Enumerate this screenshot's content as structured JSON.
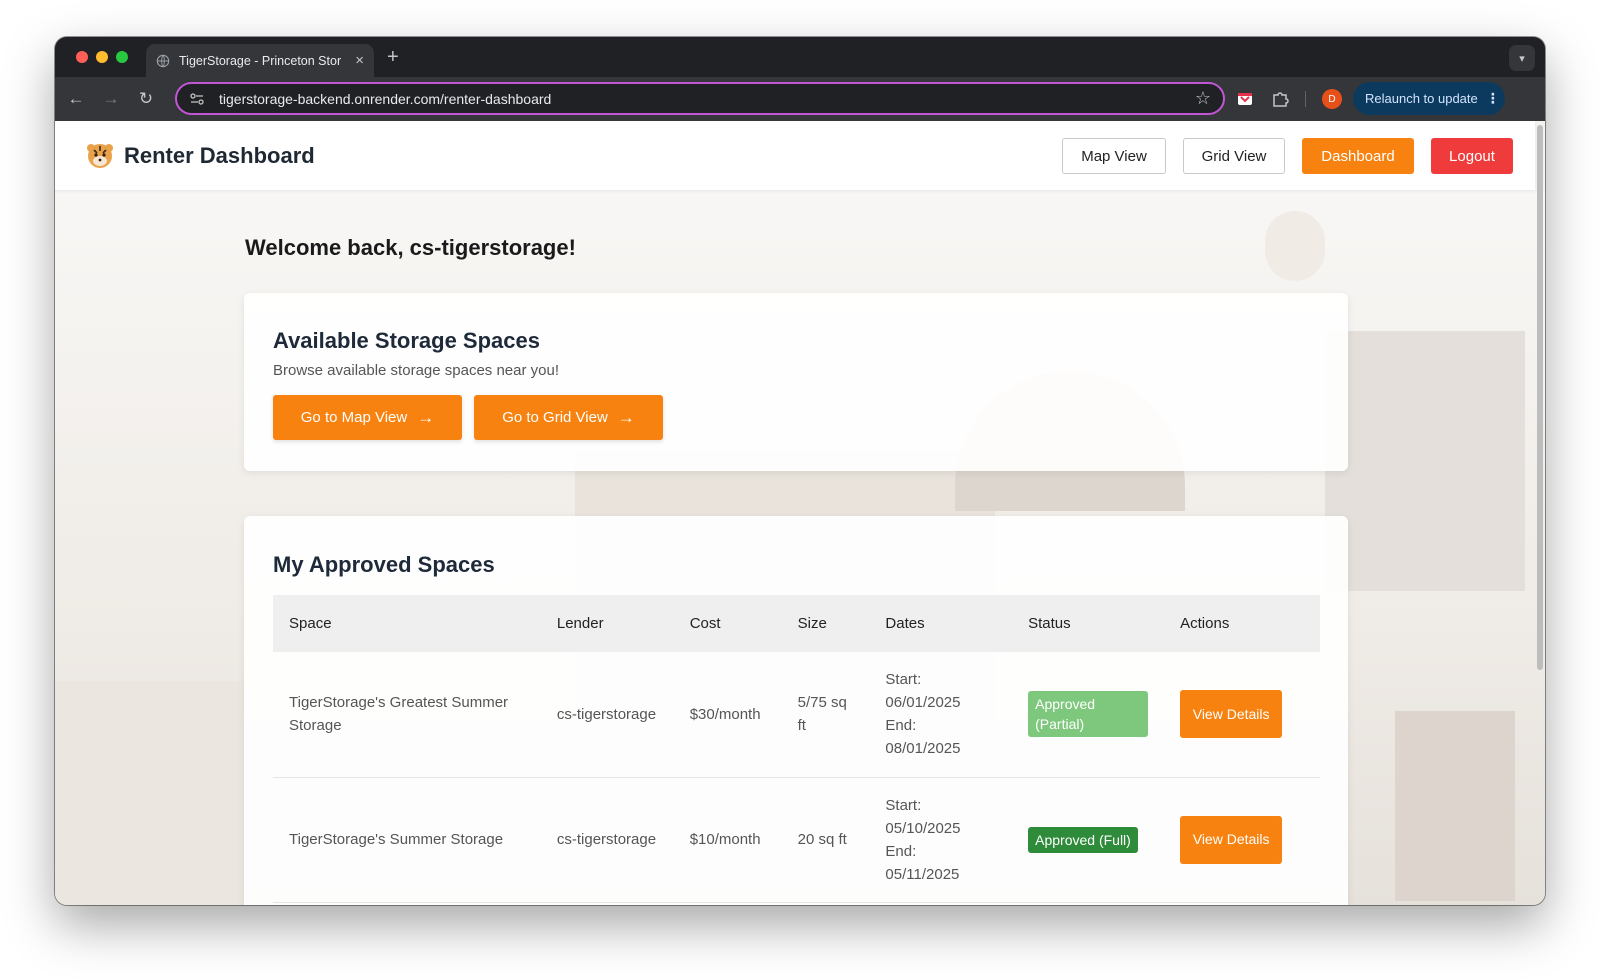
{
  "browser": {
    "tab_title": "TigerStorage - Princeton Stor",
    "url": "tigerstorage-backend.onrender.com/renter-dashboard",
    "profile_initial": "D",
    "relaunch_label": "Relaunch to update",
    "new_tab_symbol": "+"
  },
  "header": {
    "title": "Renter Dashboard",
    "map_view_label": "Map View",
    "grid_view_label": "Grid View",
    "dashboard_label": "Dashboard",
    "logout_label": "Logout"
  },
  "welcome": "Welcome back, cs-tigerstorage!",
  "available": {
    "title": "Available Storage Spaces",
    "subtitle": "Browse available storage spaces near you!",
    "map_cta": "Go to Map View",
    "grid_cta": "Go to Grid View"
  },
  "approved": {
    "title": "My Approved Spaces",
    "columns": [
      "Space",
      "Lender",
      "Cost",
      "Size",
      "Dates",
      "Status",
      "Actions"
    ],
    "rows": [
      {
        "space": "TigerStorage's Greatest Summer Storage",
        "lender": "cs-tigerstorage",
        "cost": "$30/month",
        "size": "5/75 sq ft",
        "start_label": "Start:",
        "start": "06/01/2025",
        "end_label": "End:",
        "end": "08/01/2025",
        "status": "Approved (Partial)",
        "action": "View Details"
      },
      {
        "space": "TigerStorage's Summer Storage",
        "lender": "cs-tigerstorage",
        "cost": "$10/month",
        "size": "20 sq ft",
        "start_label": "Start:",
        "start": "05/10/2025",
        "end_label": "End:",
        "end": "05/11/2025",
        "status": "Approved (Full)",
        "action": "View Details"
      }
    ]
  },
  "colors": {
    "accent_orange": "#f7820f",
    "logout_red": "#ef3b3b",
    "status_partial": "#7ec87e",
    "status_full": "#2e8b3a"
  }
}
